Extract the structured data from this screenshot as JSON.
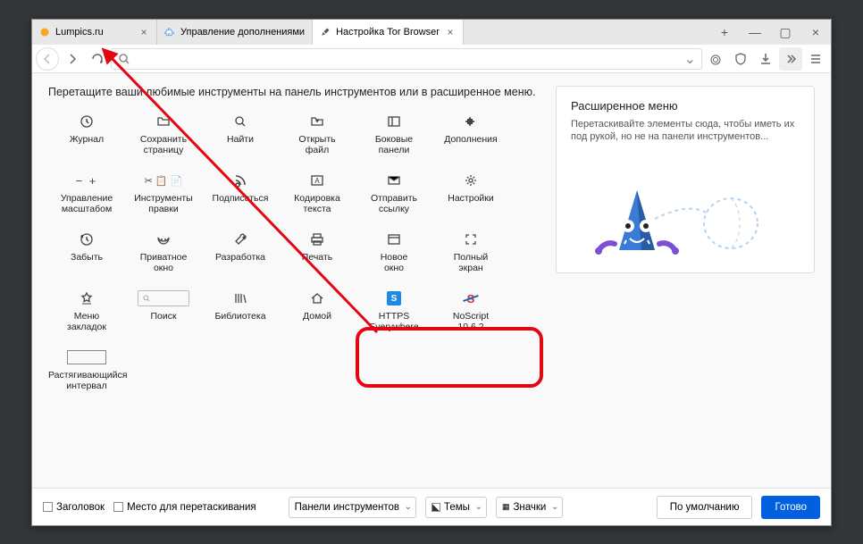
{
  "tabs": [
    {
      "label": "Lumpics.ru",
      "icon": "globe"
    },
    {
      "label": "Управление дополнениями",
      "icon": "puzzle"
    },
    {
      "label": "Настройка Tor Browser",
      "icon": "brush",
      "active": true
    }
  ],
  "instruction": "Перетащите ваши любимые инструменты на панель инструментов или в расширенное меню.",
  "tools": [
    {
      "label": "Журнал",
      "icon": "history"
    },
    {
      "label": "Сохранить страницу",
      "icon": "folder"
    },
    {
      "label": "Найти",
      "icon": "search"
    },
    {
      "label": "Открыть файл",
      "icon": "openfile"
    },
    {
      "label": "Боковые панели",
      "icon": "sidebar"
    },
    {
      "label": "Дополнения",
      "icon": "puzzle"
    },
    {
      "label": "Управление масштабом",
      "icon": "zoom"
    },
    {
      "label": "Инструменты правки",
      "icon": "edit"
    },
    {
      "label": "Подписаться",
      "icon": "rss"
    },
    {
      "label": "Кодировка текста",
      "icon": "encoding"
    },
    {
      "label": "Отправить ссылку",
      "icon": "mail"
    },
    {
      "label": "Настройки",
      "icon": "gear"
    },
    {
      "label": "Забыть",
      "icon": "forget"
    },
    {
      "label": "Приватное окно",
      "icon": "mask"
    },
    {
      "label": "Разработка",
      "icon": "wrench"
    },
    {
      "label": "Печать",
      "icon": "print"
    },
    {
      "label": "Новое окно",
      "icon": "window"
    },
    {
      "label": "Полный экран",
      "icon": "fullscreen"
    },
    {
      "label": "Меню закладок",
      "icon": "bookmarks"
    },
    {
      "label": "Поиск",
      "icon": "searchbox"
    },
    {
      "label": "Библиотека",
      "icon": "library"
    },
    {
      "label": "Домой",
      "icon": "home"
    },
    {
      "label": "HTTPS Everywhere",
      "icon": "https"
    },
    {
      "label": "NoScript 10.6.2",
      "icon": "noscript"
    },
    {
      "label": "Растягивающийся интервал",
      "icon": "spacer"
    }
  ],
  "ext_menu": {
    "title": "Расширенное меню",
    "desc": "Перетаскивайте элементы сюда, чтобы иметь их под рукой, но не на панели инструментов..."
  },
  "footer": {
    "chk1": "Заголовок",
    "chk2": "Место для перетаскивания",
    "drop1": "Панели инструментов",
    "drop2": "Темы",
    "drop3": "Значки",
    "defaults": "По умолчанию",
    "done": "Готово"
  }
}
